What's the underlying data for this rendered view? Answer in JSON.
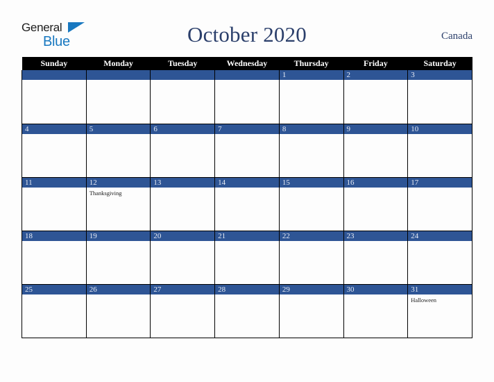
{
  "logo": {
    "word_one": "General",
    "word_two": "Blue",
    "triangle_color": "#1878c0",
    "text_color": "#1d1d1d"
  },
  "header": {
    "title": "October 2020",
    "country": "Canada",
    "title_color": "#2b3f6b"
  },
  "colors": {
    "header_row_bg": "#000000",
    "date_band_bg": "#2e5595",
    "date_text": "#e8ecf5",
    "page_bg": "#fdfdfd",
    "grid_border": "#000000"
  },
  "calendar": {
    "weekday_headers": [
      "Sunday",
      "Monday",
      "Tuesday",
      "Wednesday",
      "Thursday",
      "Friday",
      "Saturday"
    ],
    "weeks": [
      [
        {
          "day": "",
          "events": []
        },
        {
          "day": "",
          "events": []
        },
        {
          "day": "",
          "events": []
        },
        {
          "day": "",
          "events": []
        },
        {
          "day": "1",
          "events": []
        },
        {
          "day": "2",
          "events": []
        },
        {
          "day": "3",
          "events": []
        }
      ],
      [
        {
          "day": "4",
          "events": []
        },
        {
          "day": "5",
          "events": []
        },
        {
          "day": "6",
          "events": []
        },
        {
          "day": "7",
          "events": []
        },
        {
          "day": "8",
          "events": []
        },
        {
          "day": "9",
          "events": []
        },
        {
          "day": "10",
          "events": []
        }
      ],
      [
        {
          "day": "11",
          "events": []
        },
        {
          "day": "12",
          "events": [
            "Thanksgiving"
          ]
        },
        {
          "day": "13",
          "events": []
        },
        {
          "day": "14",
          "events": []
        },
        {
          "day": "15",
          "events": []
        },
        {
          "day": "16",
          "events": []
        },
        {
          "day": "17",
          "events": []
        }
      ],
      [
        {
          "day": "18",
          "events": []
        },
        {
          "day": "19",
          "events": []
        },
        {
          "day": "20",
          "events": []
        },
        {
          "day": "21",
          "events": []
        },
        {
          "day": "22",
          "events": []
        },
        {
          "day": "23",
          "events": []
        },
        {
          "day": "24",
          "events": []
        }
      ],
      [
        {
          "day": "25",
          "events": []
        },
        {
          "day": "26",
          "events": []
        },
        {
          "day": "27",
          "events": []
        },
        {
          "day": "28",
          "events": []
        },
        {
          "day": "29",
          "events": []
        },
        {
          "day": "30",
          "events": []
        },
        {
          "day": "31",
          "events": [
            "Halloween"
          ]
        }
      ]
    ]
  }
}
